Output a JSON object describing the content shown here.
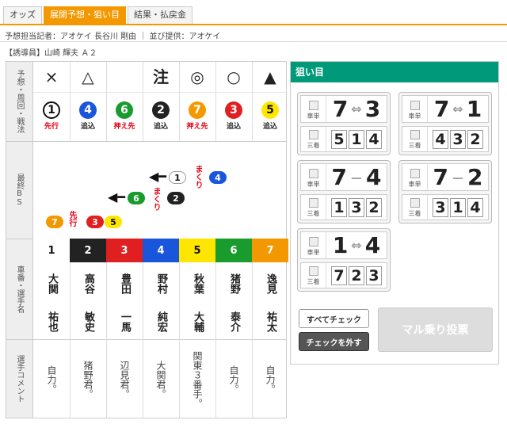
{
  "tabs": [
    {
      "label": "オッズ",
      "active": false
    },
    {
      "label": "展開予想・狙い目",
      "active": true
    },
    {
      "label": "結果・払戻金",
      "active": false
    }
  ],
  "info_text": "予想担当記者：アオケイ 長谷川 剛由 ｜ 並び提供：アオケイ",
  "lead_text": "【誘導員】山崎 輝夫 Ａ２",
  "grid": {
    "headers": {
      "prediction": "予想・周回・戦法",
      "bs": "最終BS",
      "number": "車番・選手名",
      "comment": "選手コメント"
    },
    "marks": [
      "×",
      "△",
      "",
      "注",
      "◎",
      "○",
      "▲"
    ],
    "lineup": [
      {
        "num": "1",
        "tactic": "先行",
        "color": "#ffffff",
        "text": "#111111",
        "tactic_red": true
      },
      {
        "num": "4",
        "tactic": "追込",
        "color": "#1a56db",
        "text": "#ffffff",
        "tactic_red": false
      },
      {
        "num": "6",
        "tactic": "押え先",
        "color": "#1a9b2e",
        "text": "#ffffff",
        "tactic_red": true
      },
      {
        "num": "2",
        "tactic": "追込",
        "color": "#222222",
        "text": "#ffffff",
        "tactic_red": false
      },
      {
        "num": "7",
        "tactic": "押え先",
        "color": "#f39800",
        "text": "#ffffff",
        "tactic_red": true
      },
      {
        "num": "3",
        "tactic": "追込",
        "color": "#e02020",
        "text": "#ffffff",
        "tactic_red": false
      },
      {
        "num": "5",
        "tactic": "追込",
        "color": "#ffe600",
        "text": "#111111",
        "tactic_red": false
      }
    ],
    "bs": {
      "row1": {
        "a": "1",
        "note": "まくり",
        "b": "4"
      },
      "row2": {
        "a": "6",
        "note": "まくり",
        "b": "2"
      },
      "row3": {
        "a": "7",
        "note": "先行",
        "b": "3",
        "c": "5"
      }
    },
    "riders": [
      {
        "num": "1",
        "bg": "#ffffff",
        "fg": "#111111",
        "name1": "大関",
        "name2": "祐也",
        "comment": "自力。"
      },
      {
        "num": "2",
        "bg": "#222222",
        "fg": "#ffffff",
        "name1": "高谷",
        "name2": "敏史",
        "comment": "猪野君。"
      },
      {
        "num": "3",
        "bg": "#e02020",
        "fg": "#ffffff",
        "name1": "豊田",
        "name2": "一馬",
        "comment": "辺見君。"
      },
      {
        "num": "4",
        "bg": "#1a56db",
        "fg": "#ffffff",
        "name1": "野村",
        "name2": "純宏",
        "comment": "大関君。"
      },
      {
        "num": "5",
        "bg": "#ffe600",
        "fg": "#111111",
        "name1": "秋葉",
        "name2": "大輔",
        "comment": "関東３番手。"
      },
      {
        "num": "6",
        "bg": "#1a9b2e",
        "fg": "#ffffff",
        "name1": "猪野",
        "name2": "泰介",
        "comment": "自力。"
      },
      {
        "num": "7",
        "bg": "#f39800",
        "fg": "#ffffff",
        "name1": "逸見",
        "name2": "祐太",
        "comment": "自力。"
      }
    ]
  },
  "panel": {
    "title": "狙い目",
    "label_top": "車単",
    "label_bot": "三着",
    "tickets": [
      {
        "a": "7",
        "op": "⇔",
        "b": "3",
        "third": [
          "5",
          "1",
          "4"
        ]
      },
      {
        "a": "7",
        "op": "⇔",
        "b": "1",
        "third": [
          "4",
          "3",
          "2"
        ]
      },
      {
        "a": "7",
        "op": "－",
        "b": "4",
        "third": [
          "1",
          "3",
          "2"
        ]
      },
      {
        "a": "7",
        "op": "－",
        "b": "2",
        "third": [
          "3",
          "1",
          "4"
        ]
      },
      {
        "a": "1",
        "op": "⇔",
        "b": "4",
        "third": [
          "7",
          "2",
          "3"
        ]
      }
    ],
    "btn_check_all": "すべてチェック",
    "btn_uncheck": "チェックを外す",
    "btn_vote": "マル乗り投票"
  }
}
